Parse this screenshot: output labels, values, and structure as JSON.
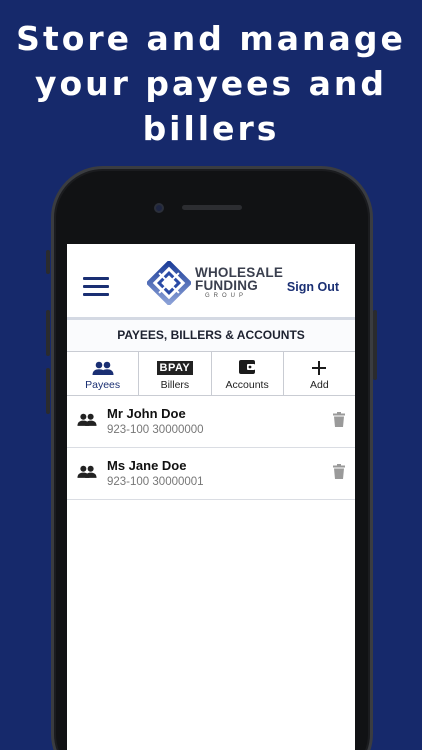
{
  "headline": {
    "line1": "Store and manage",
    "line2": "your payees and",
    "line3": "billers"
  },
  "header": {
    "logo_line1": "WHOLESALE",
    "logo_line2": "FUNDING",
    "logo_sub": "GROUP",
    "sign_out": "Sign Out"
  },
  "section_title": "PAYEES, BILLERS & ACCOUNTS",
  "tabs": [
    {
      "label": "Payees",
      "icon": "people-icon",
      "active": true
    },
    {
      "label": "Billers",
      "icon": "bpay-logo",
      "icon_text": "BPAY"
    },
    {
      "label": "Accounts",
      "icon": "wallet-icon"
    },
    {
      "label": "Add",
      "icon": "plus-icon"
    }
  ],
  "payees": [
    {
      "name": "Mr John Doe",
      "account": "923-100 30000000"
    },
    {
      "name": "Ms Jane Doe",
      "account": "923-100 30000001"
    }
  ],
  "colors": {
    "background": "#16296b",
    "brand": "#1a2f73",
    "active_tab": "#1a2f73"
  }
}
